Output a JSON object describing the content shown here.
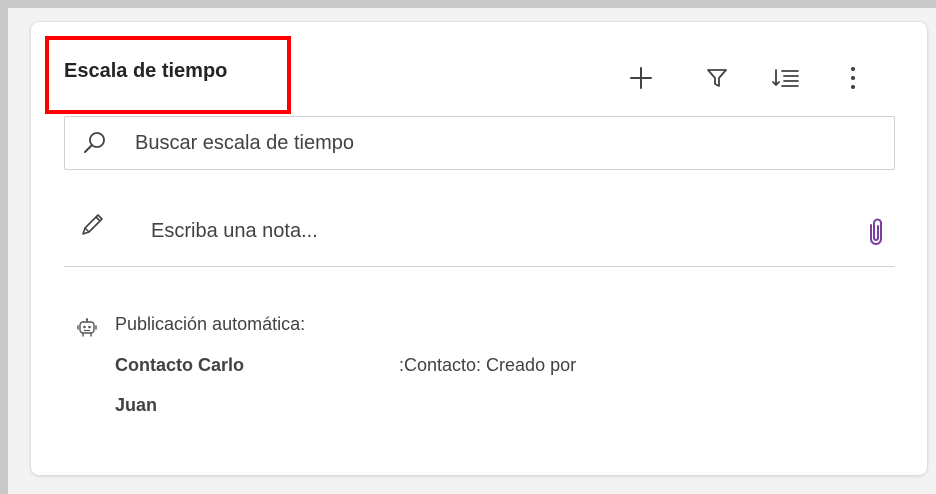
{
  "timeline": {
    "title": "Escala de tiempo",
    "toolbar": {
      "add_icon": "plus-icon",
      "filter_icon": "filter-icon",
      "sort_icon": "sort-icon",
      "more_icon": "more-vertical-icon"
    },
    "search": {
      "placeholder": "Buscar escala de tiempo",
      "icon": "search-icon"
    },
    "note": {
      "placeholder": "Escriba una nota...",
      "pencil_icon": "pencil-icon",
      "attach_icon": "paperclip-icon",
      "attach_color": "#7a3ea1"
    },
    "post": {
      "icon": "robot-icon",
      "label": "Publicación automática:",
      "name_line1": "Contacto Carlo",
      "name_line2": "Juan",
      "description": ":Contacto: Creado por"
    }
  },
  "highlight": {
    "color": "#ff0000"
  }
}
